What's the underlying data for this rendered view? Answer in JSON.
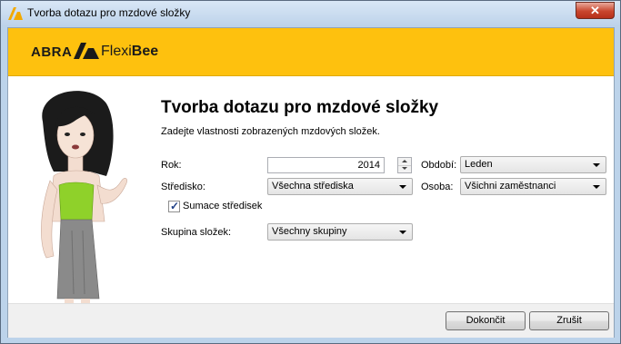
{
  "window": {
    "title": "Tvorba dotazu pro mzdové složky",
    "close_symbol": "✕"
  },
  "brand": {
    "abra": "ABRA",
    "flexi": "Flexi",
    "bee": "Bee",
    "color": "#fec10e"
  },
  "content": {
    "heading": "Tvorba dotazu pro mzdové složky",
    "subtitle": "Zadejte vlastnosti zobrazených mzdových složek."
  },
  "form": {
    "rok_label": "Rok:",
    "rok_value": "2014",
    "obdobi_label": "Období:",
    "obdobi_value": "Leden",
    "stredisko_label": "Středisko:",
    "stredisko_value": "Všechna střediska",
    "osoba_label": "Osoba:",
    "osoba_value": "Všichni zaměstnanci",
    "sumace_label": "Sumace středisek",
    "sumace_checked": true,
    "skupina_label": "Skupina složek:",
    "skupina_value": "Všechny skupiny"
  },
  "buttons": {
    "finish": "Dokončit",
    "cancel": "Zrušit"
  },
  "icons": {
    "app": "abra-logo-icon",
    "close": "close-icon"
  }
}
